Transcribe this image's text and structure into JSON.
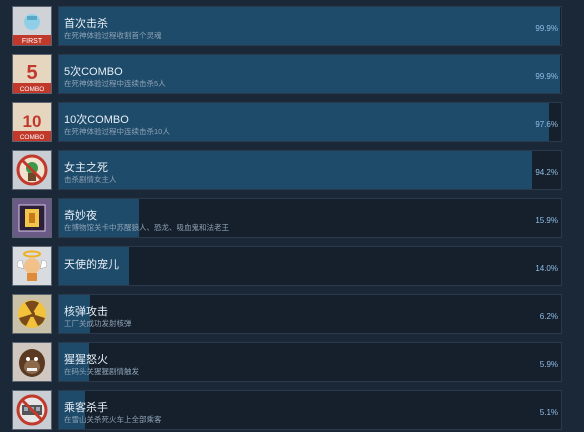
{
  "achievements": [
    {
      "title": "首次击杀",
      "desc": "在死神体验过程收割首个灵魂",
      "percent": "99.9%",
      "fill": 0.999,
      "icon": "first-kill-icon",
      "icon_text": "FIRST"
    },
    {
      "title": "5次COMBO",
      "desc": "在死神体验过程中连续击杀5人",
      "percent": "99.9%",
      "fill": 0.999,
      "icon": "combo-5-icon",
      "icon_num": "5",
      "icon_text": "COMBO"
    },
    {
      "title": "10次COMBO",
      "desc": "在死神体验过程中连续击杀10人",
      "percent": "97.6%",
      "fill": 0.976,
      "icon": "combo-10-icon",
      "icon_num": "10",
      "icon_text": "COMBO"
    },
    {
      "title": "女主之死",
      "desc": "击杀剧情女主人",
      "percent": "94.2%",
      "fill": 0.942,
      "icon": "heroine-death-icon"
    },
    {
      "title": "奇妙夜",
      "desc": "在博物馆关卡中苏醒狼人、恐龙、吸血鬼和法老王",
      "percent": "15.9%",
      "fill": 0.159,
      "icon": "museum-night-icon"
    },
    {
      "title": "天使的宠儿",
      "desc": "",
      "percent": "14.0%",
      "fill": 0.14,
      "icon": "angel-darling-icon"
    },
    {
      "title": "核弹攻击",
      "desc": "工厂关成功发射核弹",
      "percent": "6.2%",
      "fill": 0.062,
      "icon": "nuke-icon"
    },
    {
      "title": "猩猩怒火",
      "desc": "在码头关猩猩剧情触发",
      "percent": "5.9%",
      "fill": 0.059,
      "icon": "gorilla-rage-icon"
    },
    {
      "title": "乘客杀手",
      "desc": "在雪山关杀死火车上全部乘客",
      "percent": "5.1%",
      "fill": 0.051,
      "icon": "passenger-killer-icon"
    }
  ]
}
